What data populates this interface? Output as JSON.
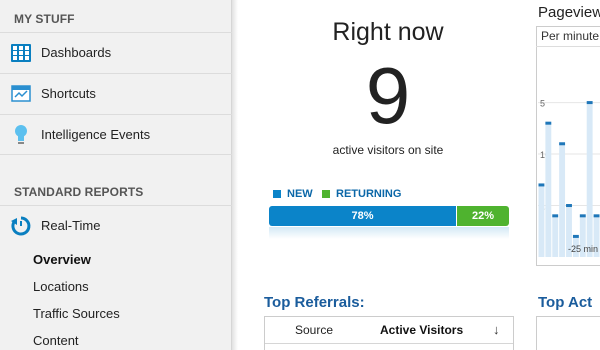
{
  "sidebar": {
    "my_stuff_header": "MY STUFF",
    "my_stuff_items": [
      {
        "label": "Dashboards",
        "icon": "dashboards-grid-icon"
      },
      {
        "label": "Shortcuts",
        "icon": "shortcuts-icon"
      },
      {
        "label": "Intelligence Events",
        "icon": "lightbulb-icon"
      }
    ],
    "standard_header": "STANDARD REPORTS",
    "realtime": {
      "label": "Real-Time",
      "icon": "realtime-clock-icon"
    },
    "realtime_subitems": [
      {
        "label": "Overview",
        "active": true
      },
      {
        "label": "Locations",
        "active": false
      },
      {
        "label": "Traffic Sources",
        "active": false
      },
      {
        "label": "Content",
        "active": false
      }
    ]
  },
  "right_now": {
    "title": "Right now",
    "count": "9",
    "subtitle": "active visitors on site",
    "legend": {
      "new": "NEW",
      "returning": "RETURNING"
    },
    "new_percent_label": "78%",
    "returning_percent_label": "22%",
    "new_fraction": 0.78,
    "returning_fraction": 0.22,
    "colors": {
      "new": "#0b84c9",
      "returning": "#4fb32f"
    }
  },
  "top_referrals": {
    "title": "Top Referrals:",
    "columns": {
      "source": "Source",
      "active_visitors": "Active Visitors"
    },
    "sort_icon": "sort-down-arrow-icon"
  },
  "pageviews": {
    "title": "Pageviews",
    "subtitle": "Per minute",
    "y_ticks": [
      "15",
      "10",
      "5"
    ],
    "x_label": "-25 min"
  },
  "top_active": {
    "title": "Top Act"
  },
  "chart_data": {
    "type": "bar",
    "title": "Pageviews",
    "subtitle": "Per minute",
    "ylim": [
      0,
      17
    ],
    "y_ticks": [
      5,
      10,
      15
    ],
    "x_tick_labels": [
      "-25 min"
    ],
    "values": [
      7,
      13,
      4,
      11,
      5,
      2,
      4,
      15,
      4
    ]
  }
}
